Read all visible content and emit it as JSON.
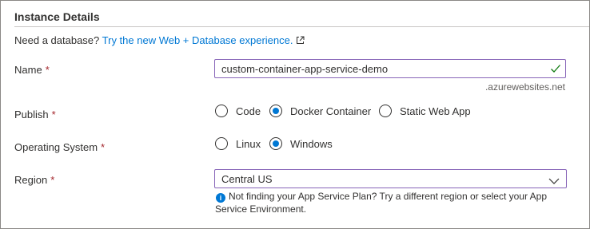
{
  "section": {
    "title": "Instance Details",
    "db_prompt": "Need a database?",
    "db_link": "Try the new Web + Database experience."
  },
  "name": {
    "label": "Name",
    "required": "*",
    "value": "custom-container-app-service-demo",
    "suffix": ".azurewebsites.net"
  },
  "publish": {
    "label": "Publish",
    "required": "*",
    "options": [
      "Code",
      "Docker Container",
      "Static Web App"
    ],
    "selected": "Docker Container"
  },
  "os": {
    "label": "Operating System",
    "required": "*",
    "options": [
      "Linux",
      "Windows"
    ],
    "selected": "Windows"
  },
  "region": {
    "label": "Region",
    "required": "*",
    "value": "Central US",
    "info": "Not finding your App Service Plan? Try a different region or select your App Service Environment."
  },
  "colors": {
    "link": "#0078d4",
    "required": "#a4262c",
    "focus_border": "#8764b8",
    "valid_check": "#107c10"
  },
  "icons": [
    "external-link-icon",
    "checkmark-icon",
    "chevron-down-icon",
    "info-icon"
  ]
}
